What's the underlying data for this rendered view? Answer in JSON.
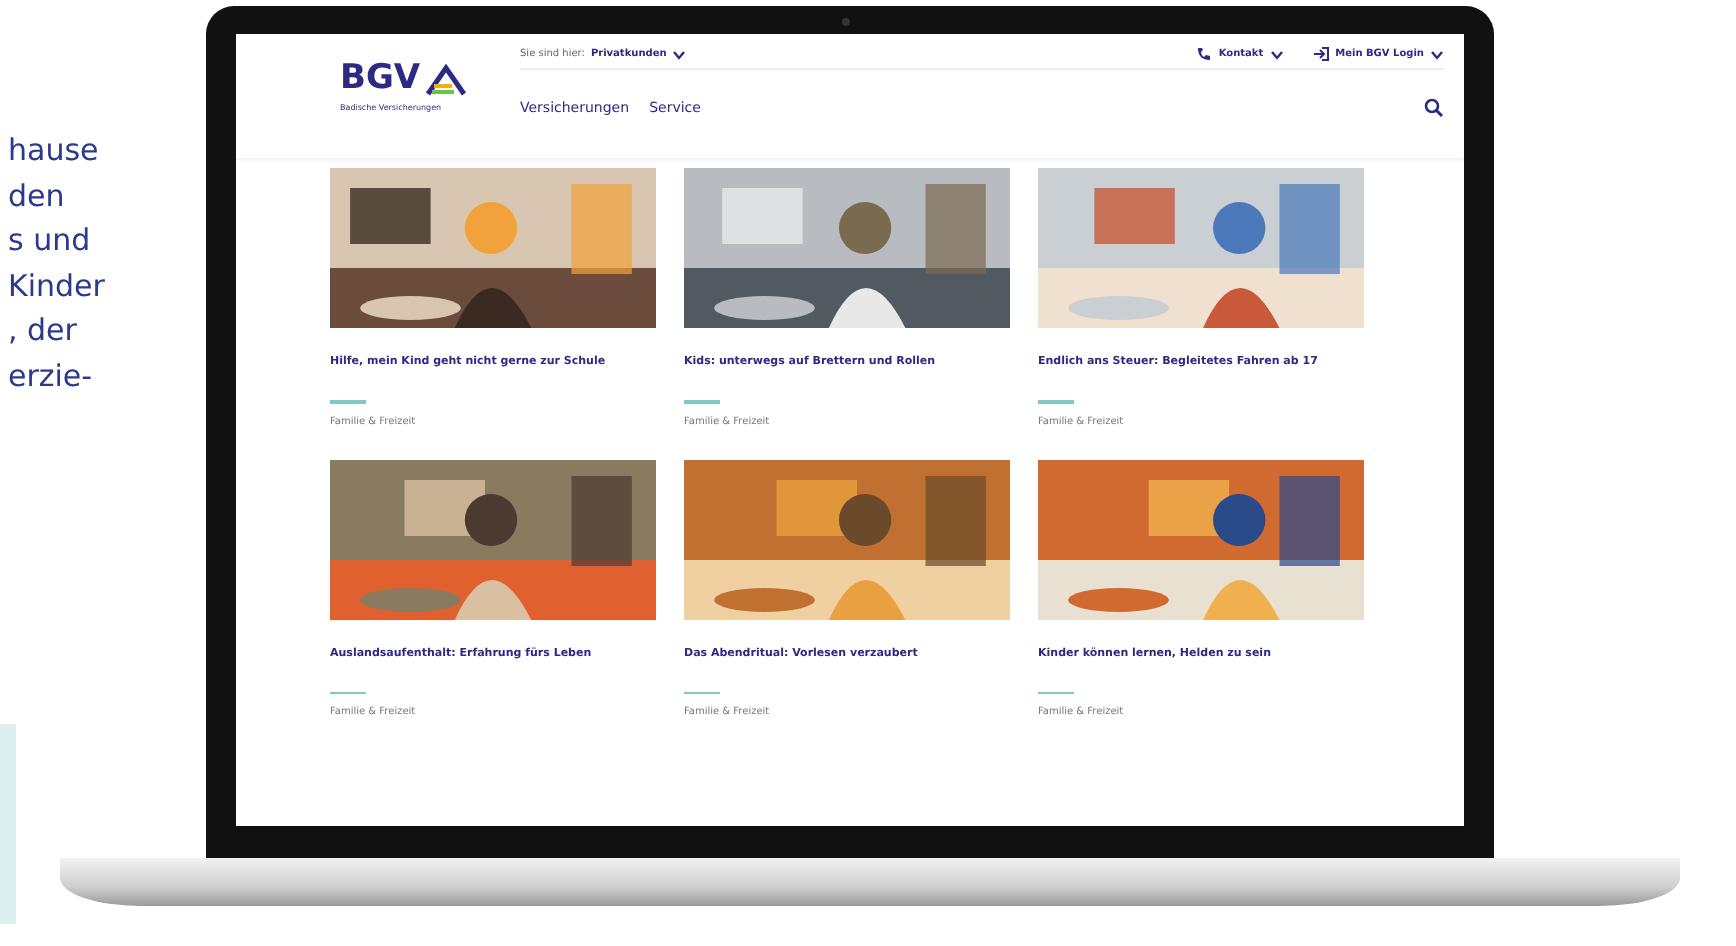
{
  "side_text": {
    "lines": [
      "hause",
      "den",
      "s und",
      "Kinder",
      ", der",
      "erzie-"
    ]
  },
  "header": {
    "logo": "BGV",
    "logo_subtitle": "Badische Versicherungen",
    "location_label": "Sie sind hier:",
    "location_value": "Privatkunden",
    "contact": "Kontakt",
    "login": "Mein BGV Login",
    "nav": [
      "Versicherungen",
      "Service"
    ]
  },
  "articles": [
    {
      "title": "Hilfe, mein Kind geht nicht gerne zur Schule",
      "category": "Familie & Freizeit"
    },
    {
      "title": "Kids: unterwegs auf Brettern und Rollen",
      "category": "Familie & Freizeit"
    },
    {
      "title": "Endlich ans Steuer: Begleitetes Fahren ab 17",
      "category": "Familie & Freizeit"
    },
    {
      "title": "Auslandsaufenthalt: Erfahrung fürs Leben",
      "category": "Familie & Freizeit"
    },
    {
      "title": "Das Abendritual: Vorlesen verzaubert",
      "category": "Familie & Freizeit"
    },
    {
      "title": "Kinder können lernen, Helden zu sein",
      "category": "Familie & Freizeit"
    }
  ]
}
